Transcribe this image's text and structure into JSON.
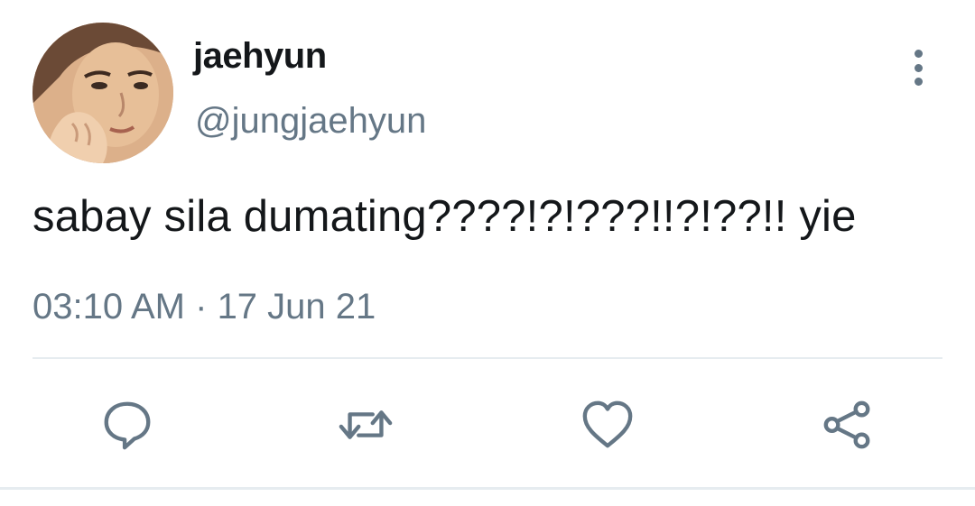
{
  "user": {
    "display_name": "jaehyun",
    "handle": "@jungjaehyun"
  },
  "tweet": {
    "text": "sabay sila dumating????!?!???!!?!??!! yie",
    "time": "03:10 AM",
    "separator": " · ",
    "date": "17 Jun 21"
  },
  "actions": [
    {
      "icon": "reply-icon"
    },
    {
      "icon": "retweet-icon"
    },
    {
      "icon": "like-icon"
    },
    {
      "icon": "share-icon"
    }
  ],
  "colors": {
    "primary_text": "#14171a",
    "secondary_text": "#657786",
    "divider": "#e6ecf0"
  }
}
